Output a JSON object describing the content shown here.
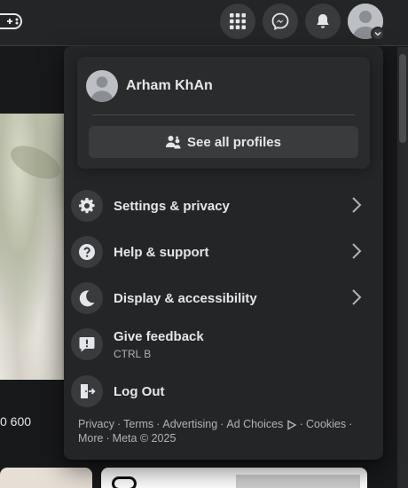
{
  "topbar": {
    "icons": [
      "game-controller-icon",
      "menu-grid-icon",
      "messenger-icon",
      "bell-icon",
      "avatar-icon",
      "chevron-down-icon"
    ]
  },
  "feed": {
    "count_text": "0 600"
  },
  "account_menu": {
    "profile": {
      "name": "Arham KhAn"
    },
    "see_all_profiles_label": "See all profiles",
    "items": [
      {
        "label": "Settings & privacy",
        "icon": "gear-icon",
        "has_chevron": true
      },
      {
        "label": "Help & support",
        "icon": "question-icon",
        "has_chevron": true
      },
      {
        "label": "Display & accessibility",
        "icon": "moon-icon",
        "has_chevron": true
      },
      {
        "label": "Give feedback",
        "sublabel": "CTRL B",
        "icon": "exclamation-icon",
        "has_chevron": false
      },
      {
        "label": "Log Out",
        "icon": "logout-icon",
        "has_chevron": false
      }
    ],
    "footer": {
      "links": [
        "Privacy",
        "Terms",
        "Advertising",
        "Ad Choices",
        "Cookies",
        "More"
      ],
      "copyright": "Meta © 2025"
    }
  },
  "colors": {
    "menu_background": "#242526",
    "card_background": "#2a2b2c",
    "button_background": "#3a3b3c",
    "primary_text": "#e4e6eb",
    "secondary_text": "#b0b3b8"
  }
}
